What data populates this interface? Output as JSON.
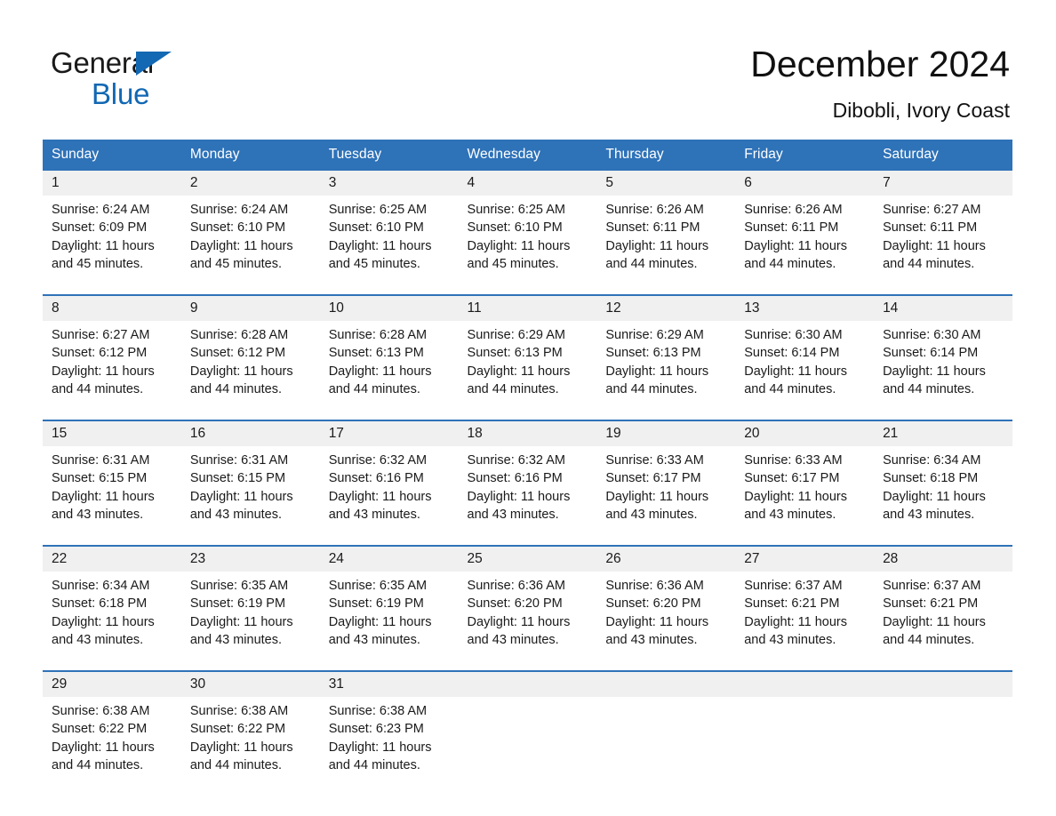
{
  "logo": {
    "word1": "General",
    "word2": "Blue",
    "triangle_color": "#1268B3"
  },
  "header": {
    "month_title": "December 2024",
    "location": "Dibobli, Ivory Coast"
  },
  "theme": {
    "header_blue": "#2E72B8",
    "daynum_band": "#f0f0f0",
    "text": "#1a1a1a"
  },
  "calendar": {
    "weekday_headers": [
      "Sunday",
      "Monday",
      "Tuesday",
      "Wednesday",
      "Thursday",
      "Friday",
      "Saturday"
    ],
    "weeks": [
      [
        {
          "day": "1",
          "sunrise": "Sunrise: 6:24 AM",
          "sunset": "Sunset: 6:09 PM",
          "daylight_1": "Daylight: 11 hours",
          "daylight_2": "and 45 minutes."
        },
        {
          "day": "2",
          "sunrise": "Sunrise: 6:24 AM",
          "sunset": "Sunset: 6:10 PM",
          "daylight_1": "Daylight: 11 hours",
          "daylight_2": "and 45 minutes."
        },
        {
          "day": "3",
          "sunrise": "Sunrise: 6:25 AM",
          "sunset": "Sunset: 6:10 PM",
          "daylight_1": "Daylight: 11 hours",
          "daylight_2": "and 45 minutes."
        },
        {
          "day": "4",
          "sunrise": "Sunrise: 6:25 AM",
          "sunset": "Sunset: 6:10 PM",
          "daylight_1": "Daylight: 11 hours",
          "daylight_2": "and 45 minutes."
        },
        {
          "day": "5",
          "sunrise": "Sunrise: 6:26 AM",
          "sunset": "Sunset: 6:11 PM",
          "daylight_1": "Daylight: 11 hours",
          "daylight_2": "and 44 minutes."
        },
        {
          "day": "6",
          "sunrise": "Sunrise: 6:26 AM",
          "sunset": "Sunset: 6:11 PM",
          "daylight_1": "Daylight: 11 hours",
          "daylight_2": "and 44 minutes."
        },
        {
          "day": "7",
          "sunrise": "Sunrise: 6:27 AM",
          "sunset": "Sunset: 6:11 PM",
          "daylight_1": "Daylight: 11 hours",
          "daylight_2": "and 44 minutes."
        }
      ],
      [
        {
          "day": "8",
          "sunrise": "Sunrise: 6:27 AM",
          "sunset": "Sunset: 6:12 PM",
          "daylight_1": "Daylight: 11 hours",
          "daylight_2": "and 44 minutes."
        },
        {
          "day": "9",
          "sunrise": "Sunrise: 6:28 AM",
          "sunset": "Sunset: 6:12 PM",
          "daylight_1": "Daylight: 11 hours",
          "daylight_2": "and 44 minutes."
        },
        {
          "day": "10",
          "sunrise": "Sunrise: 6:28 AM",
          "sunset": "Sunset: 6:13 PM",
          "daylight_1": "Daylight: 11 hours",
          "daylight_2": "and 44 minutes."
        },
        {
          "day": "11",
          "sunrise": "Sunrise: 6:29 AM",
          "sunset": "Sunset: 6:13 PM",
          "daylight_1": "Daylight: 11 hours",
          "daylight_2": "and 44 minutes."
        },
        {
          "day": "12",
          "sunrise": "Sunrise: 6:29 AM",
          "sunset": "Sunset: 6:13 PM",
          "daylight_1": "Daylight: 11 hours",
          "daylight_2": "and 44 minutes."
        },
        {
          "day": "13",
          "sunrise": "Sunrise: 6:30 AM",
          "sunset": "Sunset: 6:14 PM",
          "daylight_1": "Daylight: 11 hours",
          "daylight_2": "and 44 minutes."
        },
        {
          "day": "14",
          "sunrise": "Sunrise: 6:30 AM",
          "sunset": "Sunset: 6:14 PM",
          "daylight_1": "Daylight: 11 hours",
          "daylight_2": "and 44 minutes."
        }
      ],
      [
        {
          "day": "15",
          "sunrise": "Sunrise: 6:31 AM",
          "sunset": "Sunset: 6:15 PM",
          "daylight_1": "Daylight: 11 hours",
          "daylight_2": "and 43 minutes."
        },
        {
          "day": "16",
          "sunrise": "Sunrise: 6:31 AM",
          "sunset": "Sunset: 6:15 PM",
          "daylight_1": "Daylight: 11 hours",
          "daylight_2": "and 43 minutes."
        },
        {
          "day": "17",
          "sunrise": "Sunrise: 6:32 AM",
          "sunset": "Sunset: 6:16 PM",
          "daylight_1": "Daylight: 11 hours",
          "daylight_2": "and 43 minutes."
        },
        {
          "day": "18",
          "sunrise": "Sunrise: 6:32 AM",
          "sunset": "Sunset: 6:16 PM",
          "daylight_1": "Daylight: 11 hours",
          "daylight_2": "and 43 minutes."
        },
        {
          "day": "19",
          "sunrise": "Sunrise: 6:33 AM",
          "sunset": "Sunset: 6:17 PM",
          "daylight_1": "Daylight: 11 hours",
          "daylight_2": "and 43 minutes."
        },
        {
          "day": "20",
          "sunrise": "Sunrise: 6:33 AM",
          "sunset": "Sunset: 6:17 PM",
          "daylight_1": "Daylight: 11 hours",
          "daylight_2": "and 43 minutes."
        },
        {
          "day": "21",
          "sunrise": "Sunrise: 6:34 AM",
          "sunset": "Sunset: 6:18 PM",
          "daylight_1": "Daylight: 11 hours",
          "daylight_2": "and 43 minutes."
        }
      ],
      [
        {
          "day": "22",
          "sunrise": "Sunrise: 6:34 AM",
          "sunset": "Sunset: 6:18 PM",
          "daylight_1": "Daylight: 11 hours",
          "daylight_2": "and 43 minutes."
        },
        {
          "day": "23",
          "sunrise": "Sunrise: 6:35 AM",
          "sunset": "Sunset: 6:19 PM",
          "daylight_1": "Daylight: 11 hours",
          "daylight_2": "and 43 minutes."
        },
        {
          "day": "24",
          "sunrise": "Sunrise: 6:35 AM",
          "sunset": "Sunset: 6:19 PM",
          "daylight_1": "Daylight: 11 hours",
          "daylight_2": "and 43 minutes."
        },
        {
          "day": "25",
          "sunrise": "Sunrise: 6:36 AM",
          "sunset": "Sunset: 6:20 PM",
          "daylight_1": "Daylight: 11 hours",
          "daylight_2": "and 43 minutes."
        },
        {
          "day": "26",
          "sunrise": "Sunrise: 6:36 AM",
          "sunset": "Sunset: 6:20 PM",
          "daylight_1": "Daylight: 11 hours",
          "daylight_2": "and 43 minutes."
        },
        {
          "day": "27",
          "sunrise": "Sunrise: 6:37 AM",
          "sunset": "Sunset: 6:21 PM",
          "daylight_1": "Daylight: 11 hours",
          "daylight_2": "and 43 minutes."
        },
        {
          "day": "28",
          "sunrise": "Sunrise: 6:37 AM",
          "sunset": "Sunset: 6:21 PM",
          "daylight_1": "Daylight: 11 hours",
          "daylight_2": "and 44 minutes."
        }
      ],
      [
        {
          "day": "29",
          "sunrise": "Sunrise: 6:38 AM",
          "sunset": "Sunset: 6:22 PM",
          "daylight_1": "Daylight: 11 hours",
          "daylight_2": "and 44 minutes."
        },
        {
          "day": "30",
          "sunrise": "Sunrise: 6:38 AM",
          "sunset": "Sunset: 6:22 PM",
          "daylight_1": "Daylight: 11 hours",
          "daylight_2": "and 44 minutes."
        },
        {
          "day": "31",
          "sunrise": "Sunrise: 6:38 AM",
          "sunset": "Sunset: 6:23 PM",
          "daylight_1": "Daylight: 11 hours",
          "daylight_2": "and 44 minutes."
        },
        {
          "day": "",
          "sunrise": "",
          "sunset": "",
          "daylight_1": "",
          "daylight_2": ""
        },
        {
          "day": "",
          "sunrise": "",
          "sunset": "",
          "daylight_1": "",
          "daylight_2": ""
        },
        {
          "day": "",
          "sunrise": "",
          "sunset": "",
          "daylight_1": "",
          "daylight_2": ""
        },
        {
          "day": "",
          "sunrise": "",
          "sunset": "",
          "daylight_1": "",
          "daylight_2": ""
        }
      ]
    ]
  }
}
